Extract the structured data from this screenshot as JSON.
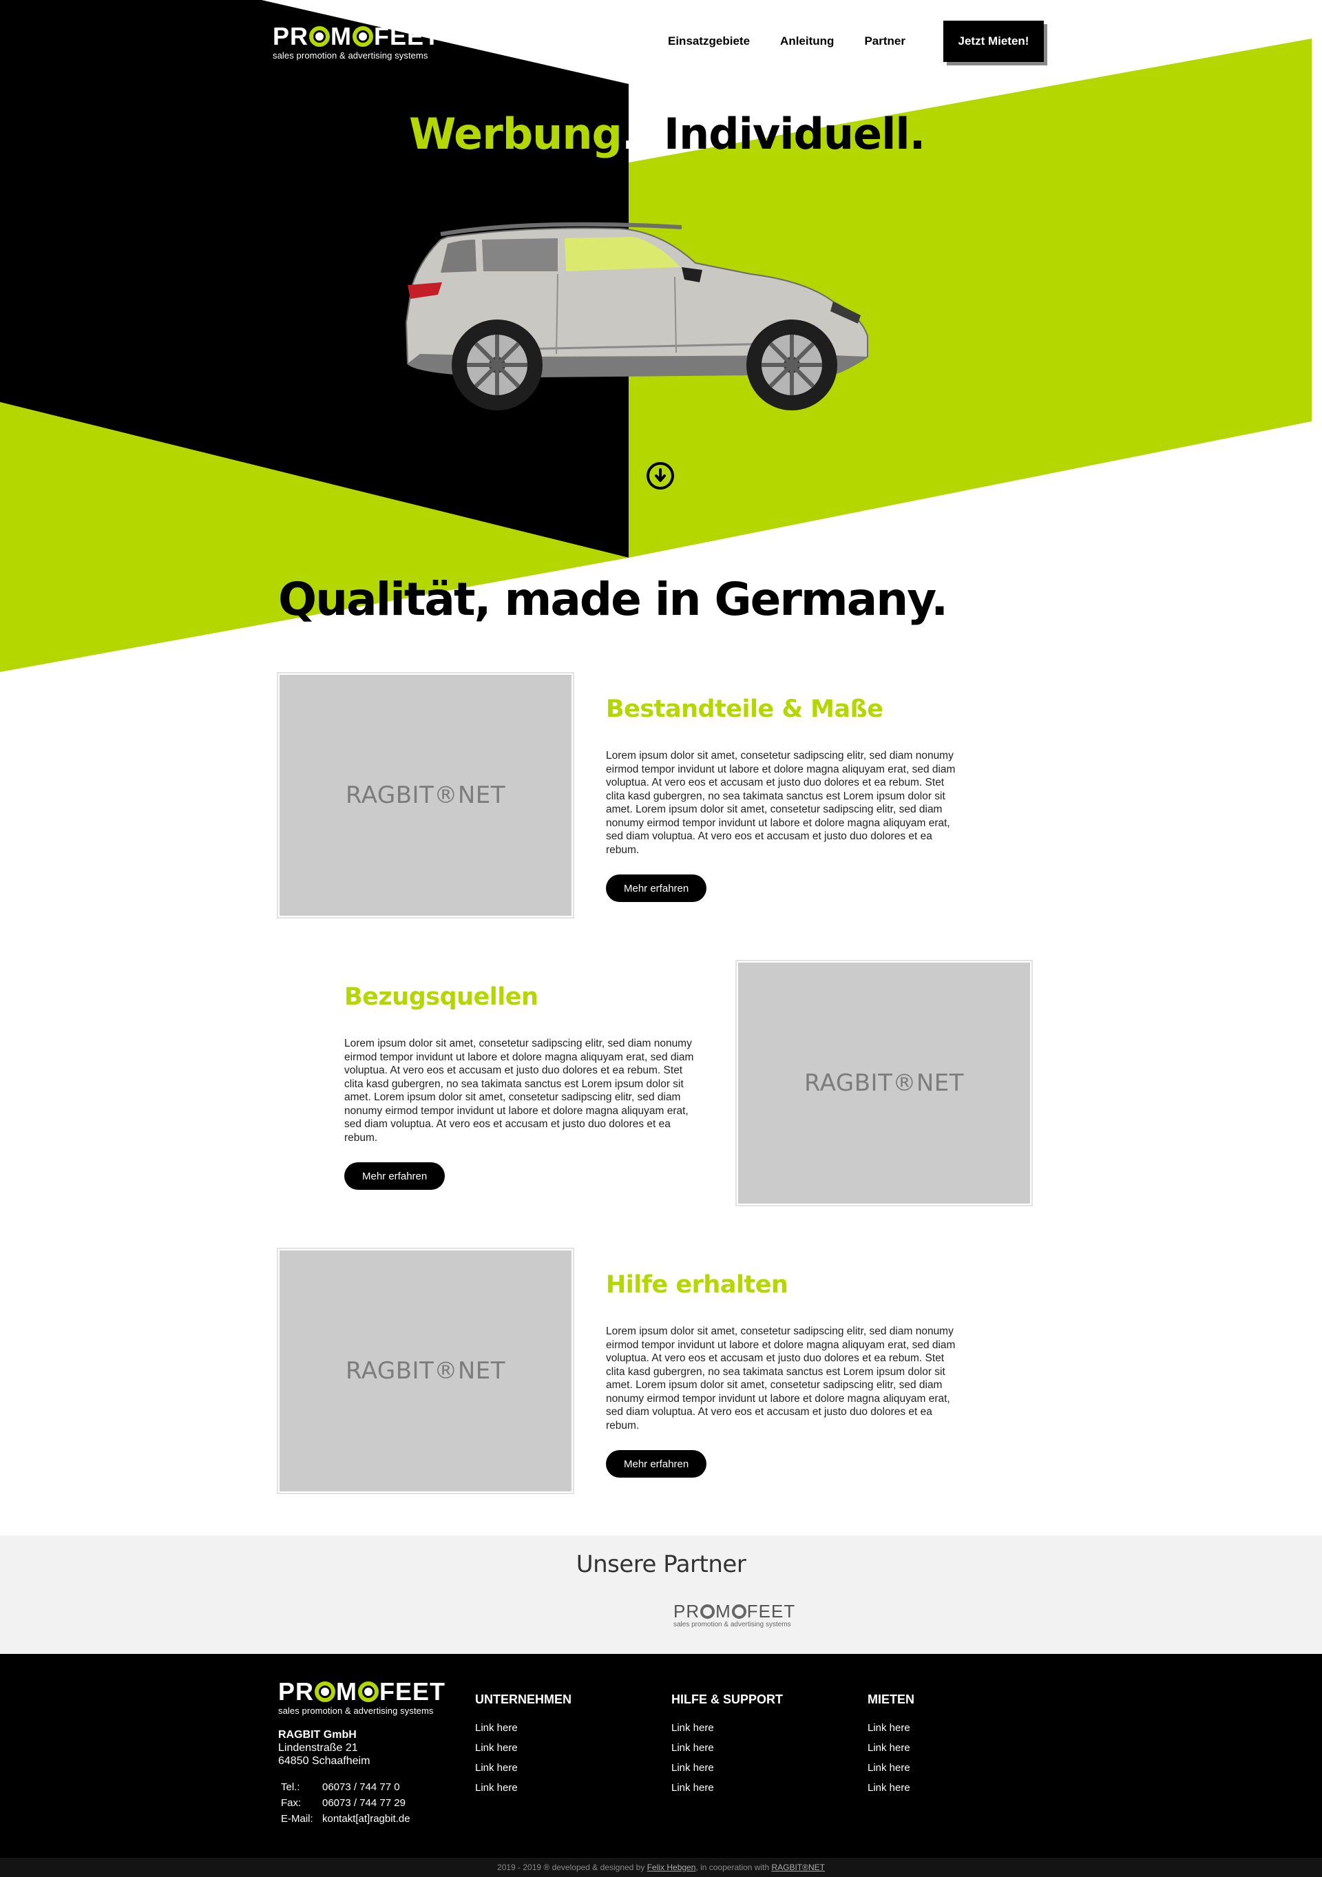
{
  "colors": {
    "accent": "#b4d700",
    "dark": "#000000",
    "placeholder": "#cbcbcb"
  },
  "brand": {
    "name_part1": "PR",
    "name_part2": "M",
    "name_part3": "FEET",
    "tagline": "sales promotion & advertising systems"
  },
  "nav": {
    "items": [
      "Einsatzgebiete",
      "Anleitung",
      "Partner"
    ],
    "cta": "Jetzt Mieten!"
  },
  "hero": {
    "title_left": "Werbung",
    "title_right": "Individuell",
    "dot": ".",
    "scroll_icon": "arrow-down-circle-icon"
  },
  "quality_title": "Qualität, made in Germany.",
  "features": [
    {
      "title": "Bestandteile & Maße",
      "image_text": "RAGBIT®NET",
      "body": "Lorem ipsum dolor sit amet, consetetur sadipscing elitr, sed diam nonumy eirmod tempor invidunt ut labore et dolore magna aliquyam erat, sed diam voluptua. At vero eos et accusam et justo duo dolores et ea rebum. Stet clita kasd gubergren, no sea takimata sanctus est Lorem ipsum dolor sit amet. Lorem ipsum dolor sit amet, consetetur sadipscing elitr, sed diam nonumy eirmod tempor invidunt ut labore et dolore magna aliquyam erat, sed diam voluptua. At vero eos et accusam et justo duo dolores et ea rebum.",
      "button": "Mehr erfahren"
    },
    {
      "title": "Bezugsquellen",
      "image_text": "RAGBIT®NET",
      "body": "Lorem ipsum dolor sit amet, consetetur sadipscing elitr, sed diam nonumy eirmod tempor invidunt ut labore et dolore magna aliquyam erat, sed diam voluptua. At vero eos et accusam et justo duo dolores et ea rebum. Stet clita kasd gubergren, no sea takimata sanctus est Lorem ipsum dolor sit amet. Lorem ipsum dolor sit amet, consetetur sadipscing elitr, sed diam nonumy eirmod tempor invidunt ut labore et dolore magna aliquyam erat, sed diam voluptua. At vero eos et accusam et justo duo dolores et ea rebum.",
      "button": "Mehr erfahren"
    },
    {
      "title": "Hilfe erhalten",
      "image_text": "RAGBIT®NET",
      "body": "Lorem ipsum dolor sit amet, consetetur sadipscing elitr, sed diam nonumy eirmod tempor invidunt ut labore et dolore magna aliquyam erat, sed diam voluptua. At vero eos et accusam et justo duo dolores et ea rebum. Stet clita kasd gubergren, no sea takimata sanctus est Lorem ipsum dolor sit amet. Lorem ipsum dolor sit amet, consetetur sadipscing elitr, sed diam nonumy eirmod tempor invidunt ut labore et dolore magna aliquyam erat, sed diam voluptua. At vero eos et accusam et justo duo dolores et ea rebum.",
      "button": "Mehr erfahren"
    }
  ],
  "partners": {
    "title": "Unsere Partner",
    "logo_tagline": "sales promotion & advertising systems"
  },
  "footer": {
    "company": {
      "name": "RAGBIT GmbH",
      "street": "Lindenstraße 21",
      "city": "64850 Schaafheim"
    },
    "contact": [
      {
        "label": "Tel.:",
        "value": "06073 / 744 77 0"
      },
      {
        "label": "Fax:",
        "value": "06073 / 744 77 29"
      },
      {
        "label": "E-Mail:",
        "value": "kontakt[at]ragbit.de"
      }
    ],
    "columns": [
      {
        "heading": "UNTERNEHMEN",
        "links": [
          "Link here",
          "Link here",
          "Link here",
          "Link here"
        ]
      },
      {
        "heading": "HILFE & SUPPORT",
        "links": [
          "Link here",
          "Link here",
          "Link here",
          "Link here"
        ]
      },
      {
        "heading": "MIETEN",
        "links": [
          "Link here",
          "Link here",
          "Link here",
          "Link here"
        ]
      }
    ],
    "copyright_prefix": "2019 - 2019 ® developed & designed by ",
    "copyright_author": "Felix Hebgen",
    "copyright_middle": ", in cooperation with ",
    "copyright_partner": "RAGBIT®NET"
  }
}
